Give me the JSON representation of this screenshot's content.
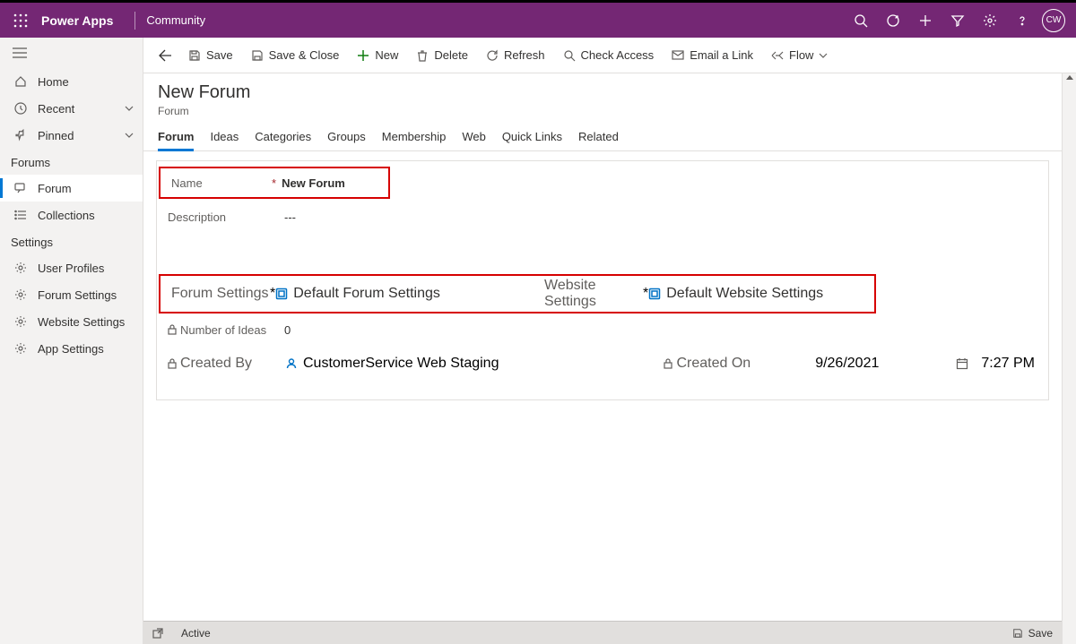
{
  "topbar": {
    "brand": "Power Apps",
    "subname": "Community",
    "avatar": "CW"
  },
  "leftnav": {
    "home": "Home",
    "recent": "Recent",
    "pinned": "Pinned",
    "section_forums": "Forums",
    "forum": "Forum",
    "collections": "Collections",
    "section_settings": "Settings",
    "user_profiles": "User Profiles",
    "forum_settings": "Forum Settings",
    "website_settings": "Website Settings",
    "app_settings": "App Settings"
  },
  "cmdbar": {
    "save": "Save",
    "save_close": "Save & Close",
    "new": "New",
    "delete": "Delete",
    "refresh": "Refresh",
    "check_access": "Check Access",
    "email_link": "Email a Link",
    "flow": "Flow"
  },
  "header": {
    "title": "New Forum",
    "subtitle": "Forum"
  },
  "tabs": [
    "Forum",
    "Ideas",
    "Categories",
    "Groups",
    "Membership",
    "Web",
    "Quick Links",
    "Related"
  ],
  "form": {
    "name_label": "Name",
    "name_value": "New Forum",
    "description_label": "Description",
    "description_value": "---",
    "forum_settings_label": "Forum Settings",
    "forum_settings_value": "Default Forum Settings",
    "website_settings_label": "Website Settings",
    "website_settings_value": "Default Website Settings",
    "num_ideas_label": "Number of Ideas",
    "num_ideas_value": "0",
    "created_by_label": "Created By",
    "created_by_value": "CustomerService Web Staging",
    "created_on_label": "Created On",
    "created_on_date": "9/26/2021",
    "created_on_time": "7:27 PM",
    "required": "*"
  },
  "statusbar": {
    "status": "Active",
    "save": "Save"
  }
}
